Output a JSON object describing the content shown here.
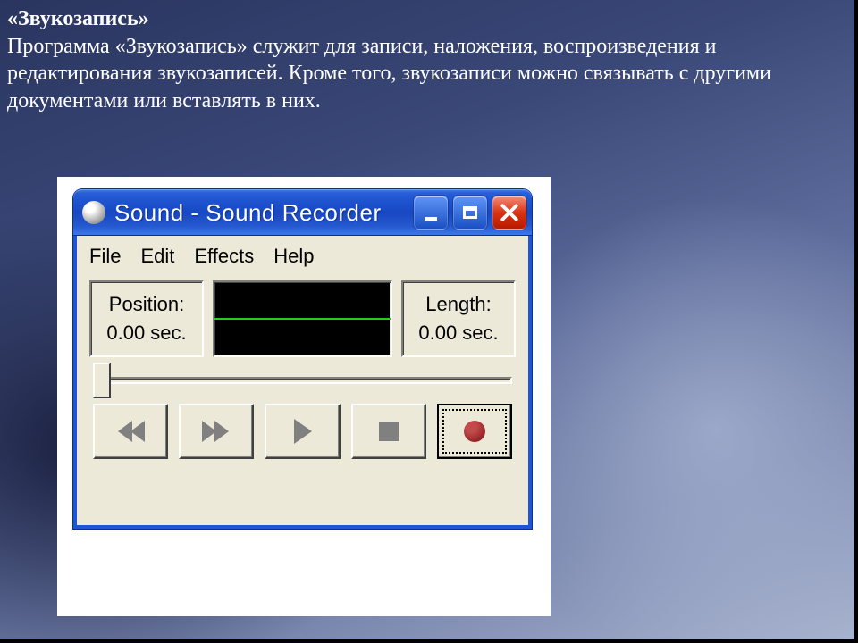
{
  "slide": {
    "title": "«Звукозапись»",
    "body": "Программа «Звукозапись» служит для записи, наложения, воспроизведения и редактирования звукозаписей. Кроме того, звукозаписи можно связывать с другими документами или вставлять в них."
  },
  "window": {
    "title": "Sound - Sound Recorder",
    "menu": {
      "file": "File",
      "edit": "Edit",
      "effects": "Effects",
      "help": "Help"
    },
    "position_label": "Position:",
    "position_value": "0.00 sec.",
    "length_label": "Length:",
    "length_value": "0.00 sec.",
    "buttons": {
      "minimize": "Minimize",
      "maximize": "Maximize",
      "close": "Close",
      "seek_start": "Seek to Start",
      "seek_end": "Seek to End",
      "play": "Play",
      "stop": "Stop",
      "record": "Record"
    }
  }
}
